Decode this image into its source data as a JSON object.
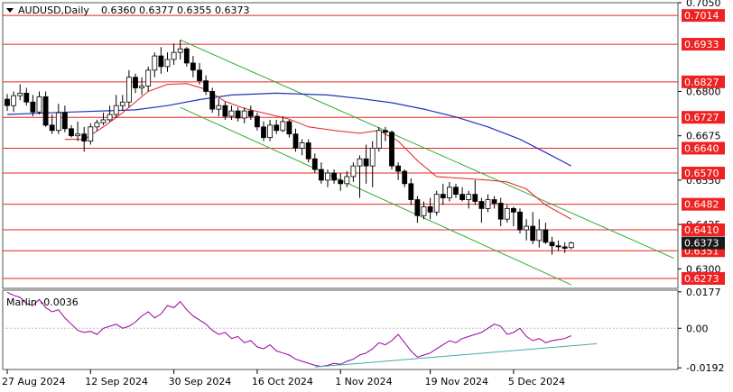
{
  "chart_data": {
    "type": "candlestick",
    "header": {
      "symbol": "AUDUSD,Daily",
      "ohlc": "0.6360 0.6377 0.6355 0.6373"
    },
    "x_labels": [
      "27 Aug 2024",
      "12 Sep 2024",
      "30 Sep 2024",
      "16 Oct 2024",
      "1 Nov 2024",
      "19 Nov 2024",
      "5 Dec 2024"
    ],
    "price_axis": {
      "ylim": [
        0.6245,
        0.705
      ],
      "ticks": [
        "0.7050",
        "0.6800",
        "0.6675",
        "0.6550",
        "0.6425",
        "0.6300"
      ]
    },
    "levels": [
      {
        "value": 0.7014,
        "label": "0.7014"
      },
      {
        "value": 0.6933,
        "label": "0.6933"
      },
      {
        "value": 0.6827,
        "label": "0.6827"
      },
      {
        "value": 0.6727,
        "label": "0.6727"
      },
      {
        "value": 0.664,
        "label": "0.6640"
      },
      {
        "value": 0.657,
        "label": "0.6570"
      },
      {
        "value": 0.6482,
        "label": "0.6482"
      },
      {
        "value": 0.641,
        "label": "0.6410"
      },
      {
        "value": 0.6351,
        "label": "0.6351"
      },
      {
        "value": 0.6273,
        "label": "0.6273"
      }
    ],
    "current_price": {
      "value": 0.6373,
      "label": "0.6373"
    },
    "candles": [
      [
        0.6778,
        0.6793,
        0.6745,
        0.676
      ],
      [
        0.676,
        0.68,
        0.6742,
        0.6788
      ],
      [
        0.6788,
        0.682,
        0.6775,
        0.6795
      ],
      [
        0.6795,
        0.681,
        0.676,
        0.677
      ],
      [
        0.677,
        0.679,
        0.673,
        0.6742
      ],
      [
        0.6742,
        0.68,
        0.6735,
        0.6785
      ],
      [
        0.6785,
        0.68,
        0.67,
        0.6705
      ],
      [
        0.6705,
        0.6735,
        0.668,
        0.669
      ],
      [
        0.669,
        0.6765,
        0.668,
        0.674
      ],
      [
        0.674,
        0.676,
        0.6685,
        0.6695
      ],
      [
        0.6695,
        0.6705,
        0.667,
        0.6675
      ],
      [
        0.6675,
        0.6715,
        0.666,
        0.668
      ],
      [
        0.668,
        0.67,
        0.663,
        0.666
      ],
      [
        0.666,
        0.671,
        0.665,
        0.67
      ],
      [
        0.67,
        0.672,
        0.669,
        0.6712
      ],
      [
        0.6712,
        0.674,
        0.6705,
        0.672
      ],
      [
        0.672,
        0.676,
        0.6715,
        0.6735
      ],
      [
        0.6735,
        0.679,
        0.6725,
        0.676
      ],
      [
        0.676,
        0.679,
        0.6745,
        0.677
      ],
      [
        0.677,
        0.686,
        0.6755,
        0.684
      ],
      [
        0.684,
        0.685,
        0.6795,
        0.681
      ],
      [
        0.681,
        0.684,
        0.679,
        0.6815
      ],
      [
        0.6815,
        0.687,
        0.68,
        0.686
      ],
      [
        0.686,
        0.691,
        0.684,
        0.69
      ],
      [
        0.69,
        0.6925,
        0.685,
        0.687
      ],
      [
        0.687,
        0.691,
        0.6855,
        0.689
      ],
      [
        0.689,
        0.6935,
        0.6875,
        0.691
      ],
      [
        0.691,
        0.6945,
        0.689,
        0.692
      ],
      [
        0.692,
        0.6925,
        0.687,
        0.688
      ],
      [
        0.688,
        0.69,
        0.684,
        0.686
      ],
      [
        0.686,
        0.688,
        0.682,
        0.683
      ],
      [
        0.683,
        0.6845,
        0.679,
        0.68
      ],
      [
        0.68,
        0.681,
        0.674,
        0.675
      ],
      [
        0.675,
        0.678,
        0.673,
        0.676
      ],
      [
        0.676,
        0.677,
        0.672,
        0.673
      ],
      [
        0.673,
        0.676,
        0.672,
        0.6745
      ],
      [
        0.6745,
        0.6755,
        0.6715,
        0.6725
      ],
      [
        0.6725,
        0.6755,
        0.671,
        0.6745
      ],
      [
        0.6745,
        0.676,
        0.672,
        0.673
      ],
      [
        0.673,
        0.674,
        0.669,
        0.67
      ],
      [
        0.67,
        0.6715,
        0.666,
        0.667
      ],
      [
        0.667,
        0.672,
        0.666,
        0.6705
      ],
      [
        0.6705,
        0.672,
        0.668,
        0.669
      ],
      [
        0.669,
        0.673,
        0.6685,
        0.6715
      ],
      [
        0.6715,
        0.672,
        0.667,
        0.668
      ],
      [
        0.668,
        0.6695,
        0.663,
        0.664
      ],
      [
        0.664,
        0.6665,
        0.662,
        0.6655
      ],
      [
        0.6655,
        0.6665,
        0.66,
        0.661
      ],
      [
        0.661,
        0.6625,
        0.657,
        0.658
      ],
      [
        0.658,
        0.66,
        0.654,
        0.655
      ],
      [
        0.655,
        0.658,
        0.653,
        0.657
      ],
      [
        0.657,
        0.658,
        0.654,
        0.655
      ],
      [
        0.655,
        0.657,
        0.652,
        0.654
      ],
      [
        0.654,
        0.6575,
        0.653,
        0.656
      ],
      [
        0.656,
        0.66,
        0.6545,
        0.659
      ],
      [
        0.659,
        0.662,
        0.65,
        0.661
      ],
      [
        0.661,
        0.665,
        0.654,
        0.659
      ],
      [
        0.659,
        0.666,
        0.653,
        0.664
      ],
      [
        0.664,
        0.67,
        0.663,
        0.669
      ],
      [
        0.669,
        0.67,
        0.666,
        0.6685
      ],
      [
        0.6685,
        0.669,
        0.658,
        0.659
      ],
      [
        0.659,
        0.66,
        0.655,
        0.6575
      ],
      [
        0.6575,
        0.658,
        0.653,
        0.654
      ],
      [
        0.654,
        0.6555,
        0.648,
        0.6495
      ],
      [
        0.6495,
        0.6505,
        0.643,
        0.645
      ],
      [
        0.645,
        0.649,
        0.644,
        0.6475
      ],
      [
        0.6475,
        0.65,
        0.644,
        0.646
      ],
      [
        0.646,
        0.652,
        0.645,
        0.651
      ],
      [
        0.651,
        0.654,
        0.648,
        0.65
      ],
      [
        0.65,
        0.6545,
        0.649,
        0.653
      ],
      [
        0.653,
        0.654,
        0.65,
        0.651
      ],
      [
        0.651,
        0.653,
        0.649,
        0.6495
      ],
      [
        0.6495,
        0.652,
        0.647,
        0.651
      ],
      [
        0.651,
        0.655,
        0.648,
        0.649
      ],
      [
        0.649,
        0.65,
        0.643,
        0.647
      ],
      [
        0.647,
        0.651,
        0.646,
        0.6495
      ],
      [
        0.6495,
        0.6505,
        0.647,
        0.6485
      ],
      [
        0.6485,
        0.65,
        0.642,
        0.644
      ],
      [
        0.644,
        0.648,
        0.643,
        0.647
      ],
      [
        0.647,
        0.6475,
        0.642,
        0.646
      ],
      [
        0.646,
        0.647,
        0.64,
        0.641
      ],
      [
        0.641,
        0.644,
        0.638,
        0.642
      ],
      [
        0.642,
        0.646,
        0.637,
        0.638
      ],
      [
        0.638,
        0.644,
        0.636,
        0.641
      ],
      [
        0.641,
        0.643,
        0.637,
        0.6375
      ],
      [
        0.6375,
        0.639,
        0.634,
        0.6365
      ],
      [
        0.6365,
        0.638,
        0.635,
        0.6362
      ],
      [
        0.6362,
        0.6375,
        0.6345,
        0.6358
      ],
      [
        0.636,
        0.6377,
        0.6355,
        0.6373
      ]
    ],
    "ma_blue": [
      [
        0,
        0.6735
      ],
      [
        10,
        0.6742
      ],
      [
        20,
        0.6748
      ],
      [
        25,
        0.676
      ],
      [
        30,
        0.6777
      ],
      [
        35,
        0.679
      ],
      [
        42,
        0.6795
      ],
      [
        50,
        0.679
      ],
      [
        55,
        0.678
      ],
      [
        60,
        0.6768
      ],
      [
        65,
        0.675
      ],
      [
        70,
        0.6728
      ],
      [
        75,
        0.67
      ],
      [
        80,
        0.6665
      ],
      [
        84,
        0.6628
      ],
      [
        88,
        0.659
      ]
    ],
    "ma_red": [
      [
        9,
        0.6665
      ],
      [
        12,
        0.6665
      ],
      [
        15,
        0.67
      ],
      [
        18,
        0.674
      ],
      [
        22,
        0.68
      ],
      [
        25,
        0.682
      ],
      [
        28,
        0.6822
      ],
      [
        31,
        0.6806
      ],
      [
        34,
        0.6772
      ],
      [
        37,
        0.6752
      ],
      [
        41,
        0.6735
      ],
      [
        44,
        0.6722
      ],
      [
        47,
        0.67
      ],
      [
        51,
        0.669
      ],
      [
        55,
        0.6682
      ],
      [
        58,
        0.669
      ],
      [
        61,
        0.666
      ],
      [
        64,
        0.6605
      ],
      [
        67,
        0.656
      ],
      [
        71,
        0.6555
      ],
      [
        75,
        0.655
      ],
      [
        78,
        0.6545
      ],
      [
        81,
        0.6525
      ],
      [
        84,
        0.648
      ],
      [
        88,
        0.644
      ]
    ],
    "channel_upper": [
      [
        27,
        0.6945
      ],
      [
        104,
        0.633
      ]
    ],
    "channel_lower": [
      [
        27,
        0.6755
      ],
      [
        88,
        0.6255
      ]
    ],
    "indicator": {
      "name": "Marlin -0.0036",
      "ticks": [
        "0.0177",
        "0.00",
        "-0.0192"
      ],
      "ylim": [
        -0.02,
        0.0185
      ],
      "values": [
        0.0175,
        0.016,
        0.015,
        0.012,
        0.011,
        0.014,
        0.01,
        0.008,
        0.009,
        0.005,
        0.002,
        -0.001,
        -0.002,
        -0.0015,
        -0.003,
        0.0,
        0.001,
        0.002,
        0.0,
        0.001,
        0.003,
        0.006,
        0.008,
        0.005,
        0.007,
        0.011,
        0.01,
        0.013,
        0.009,
        0.006,
        0.004,
        0.002,
        -0.001,
        -0.003,
        -0.002,
        -0.005,
        -0.004,
        -0.007,
        -0.006,
        -0.009,
        -0.01,
        -0.008,
        -0.011,
        -0.012,
        -0.013,
        -0.015,
        -0.016,
        -0.017,
        -0.018,
        -0.0185,
        -0.018,
        -0.017,
        -0.0175,
        -0.016,
        -0.015,
        -0.013,
        -0.012,
        -0.01,
        -0.007,
        -0.008,
        -0.006,
        -0.003,
        -0.007,
        -0.011,
        -0.014,
        -0.013,
        -0.012,
        -0.01,
        -0.008,
        -0.006,
        -0.007,
        -0.005,
        -0.004,
        -0.003,
        -0.002,
        0.0,
        0.002,
        0.001,
        -0.003,
        -0.002,
        0.0,
        -0.004,
        -0.006,
        -0.005,
        -0.007,
        -0.006,
        -0.0055,
        -0.005,
        -0.0036
      ],
      "trendline": [
        [
          48,
          -0.0188
        ],
        [
          92,
          -0.0075
        ]
      ]
    },
    "colors": {
      "bull": "#ffffff",
      "bear": "#000000",
      "level": "#ee2222",
      "ma_blue": "#2233bb",
      "ma_red": "#dd2222",
      "channel": "#33aa33",
      "indicator": "#990099",
      "trendline": "#44aaaa",
      "price_tag": "#1a1a1a"
    }
  }
}
